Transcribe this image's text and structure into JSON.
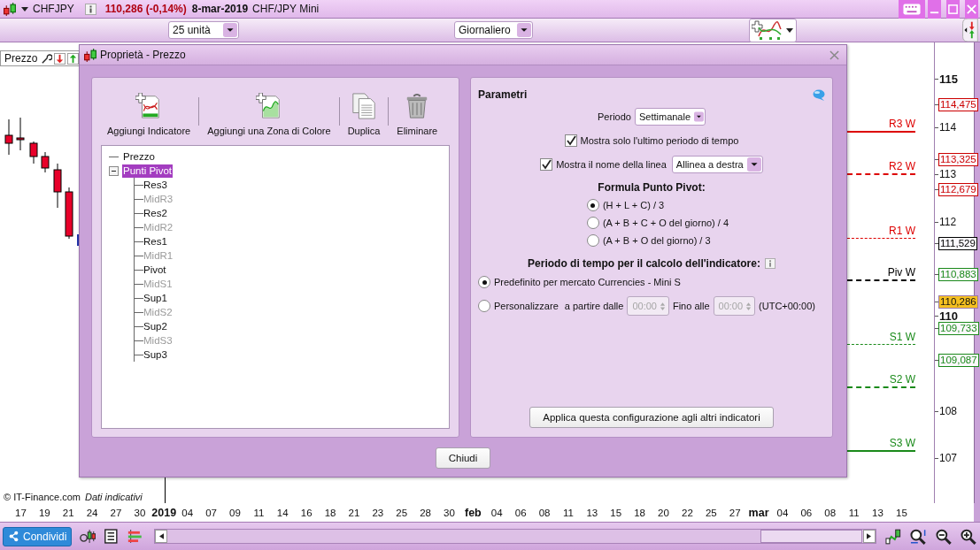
{
  "title_bar": {
    "symbol": "CHFJPY",
    "quote": "110,286 (-0,14%)",
    "date": "8-mar-2019",
    "instrument": "CHF/JPY Mini"
  },
  "toolbar": {
    "bars_dropdown": "25 unità",
    "timeframe_dropdown": "Giornaliero"
  },
  "chart": {
    "panel_title": "Prezzo",
    "pivot_lines": [
      {
        "label": "R3 W",
        "color": "#dd0000",
        "kind": "solid"
      },
      {
        "label": "R2 W",
        "color": "#dd0000",
        "kind": "dashed"
      },
      {
        "label": "R1 W",
        "color": "#dd0000",
        "kind": "thin"
      },
      {
        "label": "Piv W",
        "color": "#000000",
        "kind": "dashed"
      },
      {
        "label": "S1 W",
        "color": "#1a8a1a",
        "kind": "thin"
      },
      {
        "label": "S2 W",
        "color": "#1a8a1a",
        "kind": "dashed"
      },
      {
        "label": "S3 W",
        "color": "#1a8a1a",
        "kind": "solid"
      }
    ],
    "price_scale": [
      {
        "label": "115",
        "kind": "major"
      },
      {
        "label": "114,475",
        "kind": "tag",
        "color": "#cc0000"
      },
      {
        "label": "114",
        "kind": "tick"
      },
      {
        "label": "113,325",
        "kind": "tag",
        "color": "#cc0000"
      },
      {
        "label": "113",
        "kind": "tick"
      },
      {
        "label": "112,679",
        "kind": "tag",
        "color": "#cc0000"
      },
      {
        "label": "112",
        "kind": "tick"
      },
      {
        "label": "111,529",
        "kind": "tag",
        "color": "#000000"
      },
      {
        "label": "110,883",
        "kind": "tag",
        "color": "#1a8a1a"
      },
      {
        "label": "110,286",
        "kind": "current"
      },
      {
        "label": "110",
        "kind": "major"
      },
      {
        "label": "109,733",
        "kind": "tag",
        "color": "#1a8a1a"
      },
      {
        "label": "109,087",
        "kind": "tag",
        "color": "#1a8a1a"
      },
      {
        "label": "108",
        "kind": "tick"
      },
      {
        "label": "107",
        "kind": "tick"
      }
    ],
    "source": "© IT-Finance.com",
    "note": "Dati indicativi",
    "time_scale": [
      {
        "label": "17",
        "kind": "day"
      },
      {
        "label": "19",
        "kind": "day"
      },
      {
        "label": "21",
        "kind": "day"
      },
      {
        "label": "24",
        "kind": "day"
      },
      {
        "label": "27",
        "kind": "day"
      },
      {
        "label": "30",
        "kind": "day"
      },
      {
        "label": "2019",
        "kind": "period"
      },
      {
        "label": "04",
        "kind": "day"
      },
      {
        "label": "07",
        "kind": "day"
      },
      {
        "label": "09",
        "kind": "day"
      },
      {
        "label": "11",
        "kind": "day"
      },
      {
        "label": "14",
        "kind": "day"
      },
      {
        "label": "16",
        "kind": "day"
      },
      {
        "label": "18",
        "kind": "day"
      },
      {
        "label": "21",
        "kind": "day"
      },
      {
        "label": "23",
        "kind": "day"
      },
      {
        "label": "25",
        "kind": "day"
      },
      {
        "label": "28",
        "kind": "day"
      },
      {
        "label": "30",
        "kind": "day"
      },
      {
        "label": "feb",
        "kind": "period"
      },
      {
        "label": "04",
        "kind": "day"
      },
      {
        "label": "06",
        "kind": "day"
      },
      {
        "label": "08",
        "kind": "day"
      },
      {
        "label": "11",
        "kind": "day"
      },
      {
        "label": "13",
        "kind": "day"
      },
      {
        "label": "15",
        "kind": "day"
      },
      {
        "label": "18",
        "kind": "day"
      },
      {
        "label": "20",
        "kind": "day"
      },
      {
        "label": "22",
        "kind": "day"
      },
      {
        "label": "25",
        "kind": "day"
      },
      {
        "label": "27",
        "kind": "day"
      },
      {
        "label": "mar",
        "kind": "period"
      },
      {
        "label": "04",
        "kind": "day"
      },
      {
        "label": "06",
        "kind": "day"
      },
      {
        "label": "08",
        "kind": "day"
      },
      {
        "label": "11",
        "kind": "day"
      },
      {
        "label": "13",
        "kind": "day"
      },
      {
        "label": "15",
        "kind": "day"
      }
    ]
  },
  "dialog": {
    "title": "Proprietà - Prezzo",
    "actions": [
      {
        "kind": "add-indicator",
        "label": "Aggiungi Indicatore"
      },
      {
        "kind": "add-zone",
        "label": "Aggiungi una Zona di Colore"
      },
      {
        "kind": "duplicate",
        "label": "Duplica"
      },
      {
        "kind": "delete",
        "label": "Eliminare"
      }
    ],
    "tree": [
      {
        "label": "Prezzo",
        "selected": false
      },
      {
        "label": "Punti Pivot",
        "selected": true,
        "expanded": true,
        "children": [
          {
            "label": "Res3",
            "selected": false,
            "disabled": false
          },
          {
            "label": "MidR3",
            "selected": false,
            "disabled": true
          },
          {
            "label": "Res2",
            "selected": false,
            "disabled": false
          },
          {
            "label": "MidR2",
            "selected": false,
            "disabled": true
          },
          {
            "label": "Res1",
            "selected": false,
            "disabled": false
          },
          {
            "label": "MidR1",
            "selected": false,
            "disabled": true
          },
          {
            "label": "Pivot",
            "selected": false,
            "disabled": false
          },
          {
            "label": "MidS1",
            "selected": false,
            "disabled": true
          },
          {
            "label": "Sup1",
            "selected": false,
            "disabled": false
          },
          {
            "label": "MidS2",
            "selected": false,
            "disabled": true
          },
          {
            "label": "Sup2",
            "selected": false,
            "disabled": false
          },
          {
            "label": "MidS3",
            "selected": false,
            "disabled": true
          },
          {
            "label": "Sup3",
            "selected": false,
            "disabled": false
          }
        ]
      }
    ],
    "parameters": {
      "title": "Parametri",
      "period_label": "Periodo",
      "period_value": "Settimanale",
      "only_last_period": {
        "label": "Mostra solo l'ultimo periodo di tempo",
        "checked": true
      },
      "show_line_name": {
        "label": "Mostra il nome della linea",
        "checked": true,
        "alignment": "Allinea a destra"
      },
      "formula_heading": "Formula Punto Pivot:",
      "formulas": [
        {
          "label": "(H + L + C) / 3",
          "selected": true
        },
        {
          "label": "(A + B + C + O del giorno) / 4",
          "selected": false
        },
        {
          "label": "(A + B + O del giorno) / 3",
          "selected": false
        }
      ],
      "timeframe_heading": "Periodo di tempo per il calcolo dell'indicatore:",
      "timeframe_options": [
        {
          "kind": "preset",
          "label": "Predefinito per mercato Currencies - Mini S",
          "selected": true
        },
        {
          "kind": "custom",
          "label": "Personalizzare",
          "selected": false,
          "from_label": "a partire dalle",
          "from_value": "00:00",
          "to_label": "Fino alle",
          "to_value": "00:00",
          "timezone": "(UTC+00:00)",
          "disabled": true
        }
      ],
      "apply_button": "Applica questa configurazione agli altri indicatori"
    },
    "close_button": "Chiudi"
  },
  "bottom_bar": {
    "share_button": "Condividi"
  }
}
